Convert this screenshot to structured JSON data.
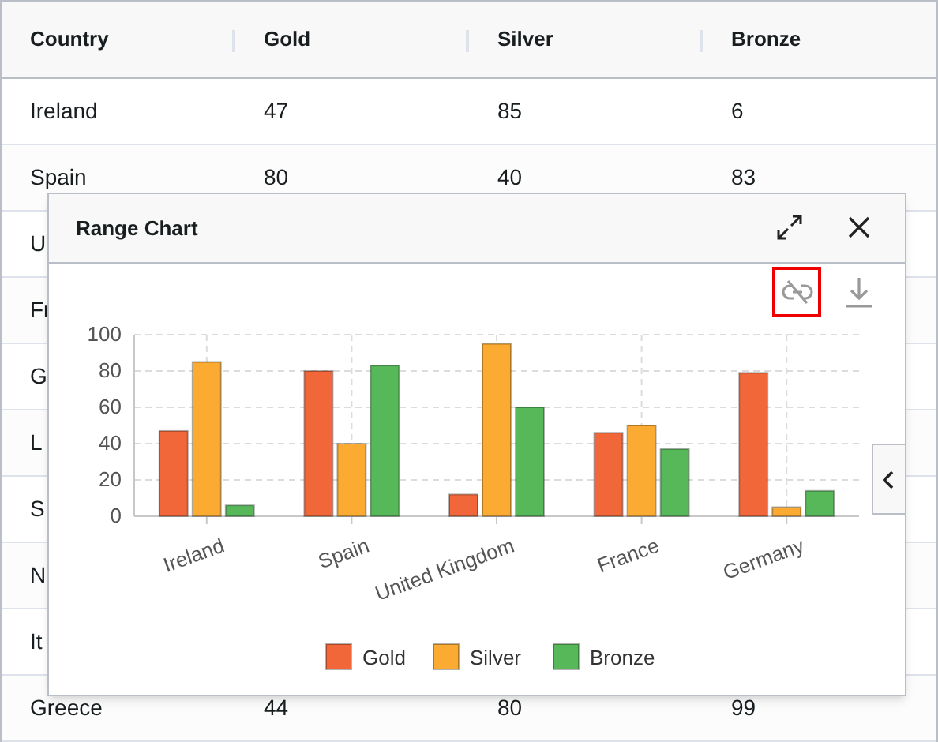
{
  "table": {
    "columns": [
      "Country",
      "Gold",
      "Silver",
      "Bronze"
    ],
    "rows": [
      [
        "Ireland",
        "47",
        "85",
        "6"
      ],
      [
        "Spain",
        "80",
        "40",
        "83"
      ],
      [
        "U"
      ],
      [
        "Fr"
      ],
      [
        "G"
      ],
      [
        "L"
      ],
      [
        "S"
      ],
      [
        "N"
      ],
      [
        "It"
      ],
      [
        "Greece",
        "44",
        "80",
        "99"
      ]
    ]
  },
  "dialog": {
    "title": "Range Chart",
    "chart_data": {
      "type": "bar",
      "grid": true,
      "legend": true,
      "categories": [
        "Ireland",
        "Spain",
        "United Kingdom",
        "France",
        "Germany"
      ],
      "ylim": [
        0,
        100
      ],
      "yticks": [
        0,
        20,
        40,
        60,
        80,
        100
      ],
      "series": [
        {
          "name": "Gold",
          "color": "#f26739",
          "values": [
            47,
            80,
            12,
            46,
            79
          ]
        },
        {
          "name": "Silver",
          "color": "#fbab31",
          "values": [
            85,
            40,
            95,
            50,
            5
          ]
        },
        {
          "name": "Bronze",
          "color": "#57b85a",
          "values": [
            6,
            83,
            60,
            37,
            14
          ]
        }
      ]
    }
  }
}
